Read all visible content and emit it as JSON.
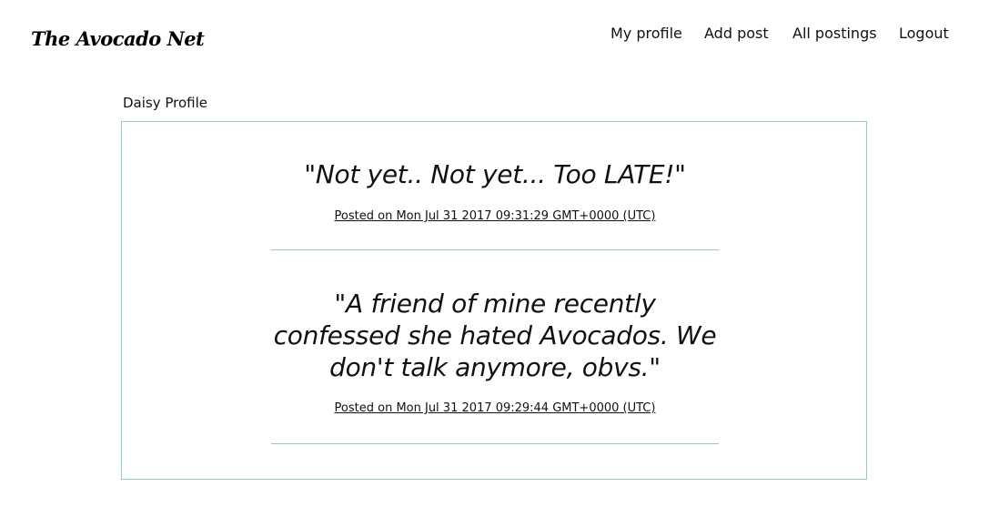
{
  "header": {
    "logo_text": "The Avocado Net",
    "nav": [
      {
        "label": "My profile"
      },
      {
        "label": "Add post"
      },
      {
        "label": "All postings"
      },
      {
        "label": "Logout"
      }
    ]
  },
  "profile": {
    "title": "Daisy Profile"
  },
  "posts": [
    {
      "quote": "\"Not yet.. Not yet... Too LATE!\"",
      "posted": "Posted on Mon Jul 31 2017 09:31:29 GMT+0000 (UTC)"
    },
    {
      "quote": "\"A friend of mine recently confessed she hated Avocados. We don't talk anymore, obvs.\"",
      "posted": "Posted on Mon Jul 31 2017 09:29:44 GMT+0000 (UTC)"
    }
  ],
  "colors": {
    "accent_border": "#8fd3ad",
    "text": "#111111"
  }
}
